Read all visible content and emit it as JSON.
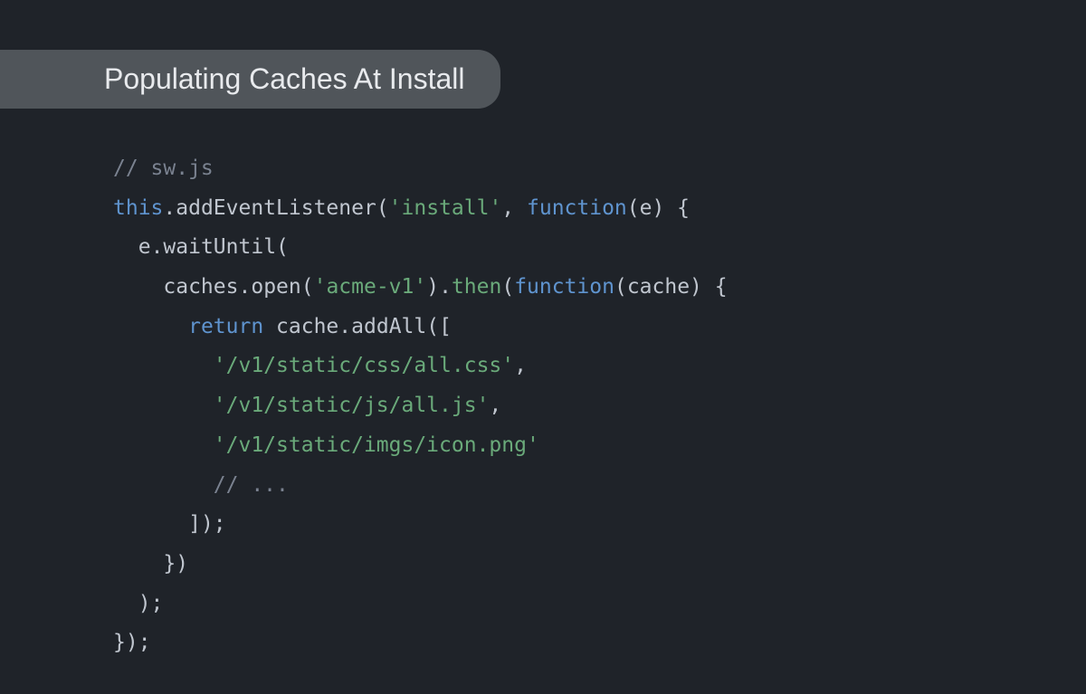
{
  "title": "Populating Caches At Install",
  "code": {
    "line1_comment": "// sw.js",
    "line2_this": "this",
    "line2_dot": ".",
    "line2_method": "addEventListener",
    "line2_open": "(",
    "line2_string": "'install'",
    "line2_comma": ", ",
    "line2_function": "function",
    "line2_params": "(e) {",
    "line3_indent": "  ",
    "line3_e": "e",
    "line3_dot": ".",
    "line3_method": "waitUntil",
    "line3_open": "(",
    "line4_indent": "    ",
    "line4_caches": "caches",
    "line4_dot1": ".",
    "line4_open": "open",
    "line4_paren1": "(",
    "line4_string": "'acme-v1'",
    "line4_paren2": ")",
    "line4_dot2": ".",
    "line4_then": "then",
    "line4_paren3": "(",
    "line4_function": "function",
    "line4_params": "(cache) {",
    "line5_indent": "      ",
    "line5_return": "return",
    "line5_space": " ",
    "line5_cache": "cache",
    "line5_dot": ".",
    "line5_method": "addAll",
    "line5_open": "([",
    "line6_indent": "        ",
    "line6_string": "'/v1/static/css/all.css'",
    "line6_comma": ",",
    "line7_indent": "        ",
    "line7_string": "'/v1/static/js/all.js'",
    "line7_comma": ",",
    "line8_indent": "        ",
    "line8_string": "'/v1/static/imgs/icon.png'",
    "line9_indent": "        ",
    "line9_comment": "// ...",
    "line10_indent": "      ",
    "line10_close": "]);",
    "line11_indent": "    ",
    "line11_close": "})",
    "line12_indent": "  ",
    "line12_close": ");",
    "line13_close": "});"
  }
}
